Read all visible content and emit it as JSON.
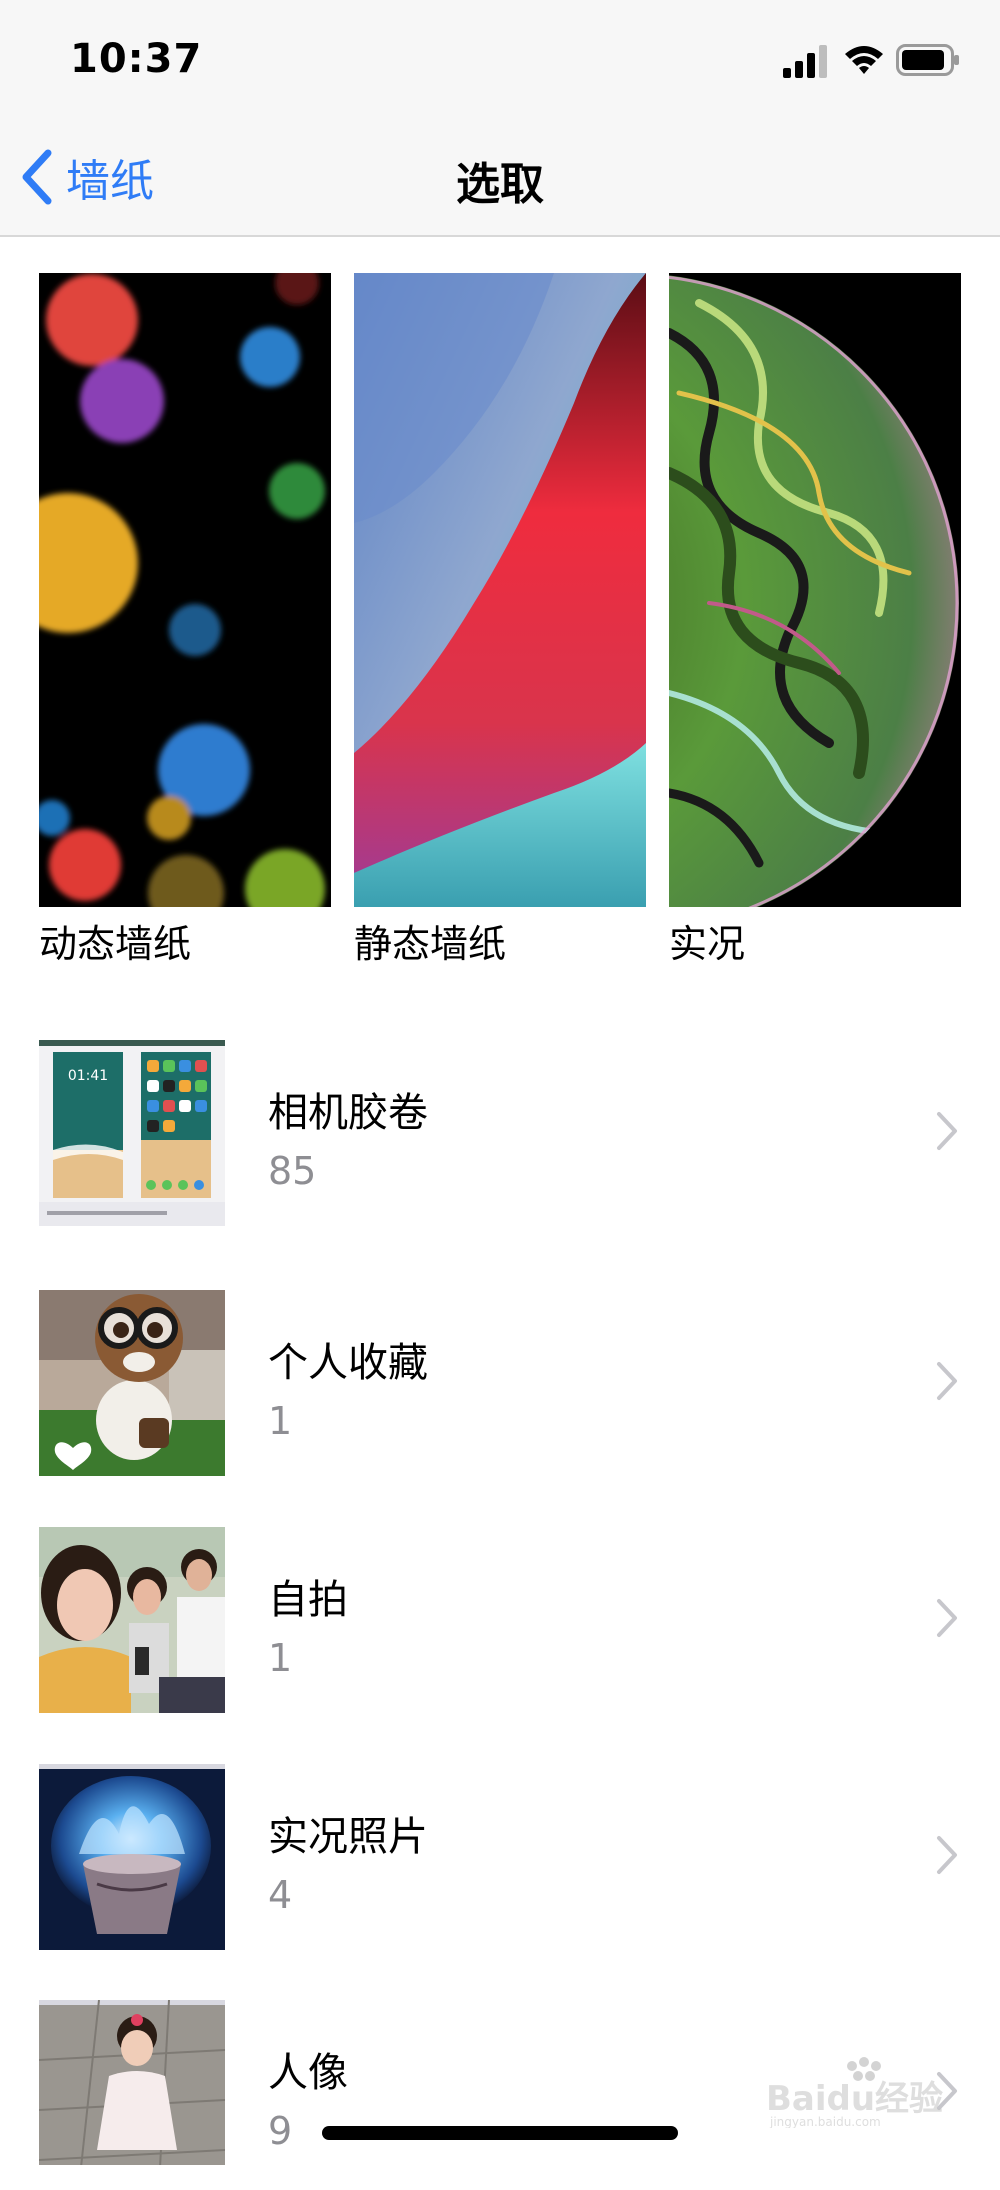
{
  "status_bar": {
    "time": "10:37"
  },
  "nav": {
    "back_label": "墙纸",
    "title": "选取"
  },
  "wallpapers": [
    {
      "label": "动态墙纸"
    },
    {
      "label": "静态墙纸"
    },
    {
      "label": "实况"
    }
  ],
  "albums": [
    {
      "name": "相机胶卷",
      "count": "85"
    },
    {
      "name": "个人收藏",
      "count": "1"
    },
    {
      "name": "自拍",
      "count": "1"
    },
    {
      "name": "实况照片",
      "count": "4"
    },
    {
      "name": "人像",
      "count": "9"
    }
  ],
  "thumb_texts": {
    "lock_time": "01:41"
  },
  "watermark": {
    "text": "Baidu经验",
    "sub": "jingyan.baidu.com"
  },
  "colors": {
    "accent": "#2f7cf6",
    "chevron": "#c7c7cc",
    "secondary_text": "#8e8e93"
  }
}
